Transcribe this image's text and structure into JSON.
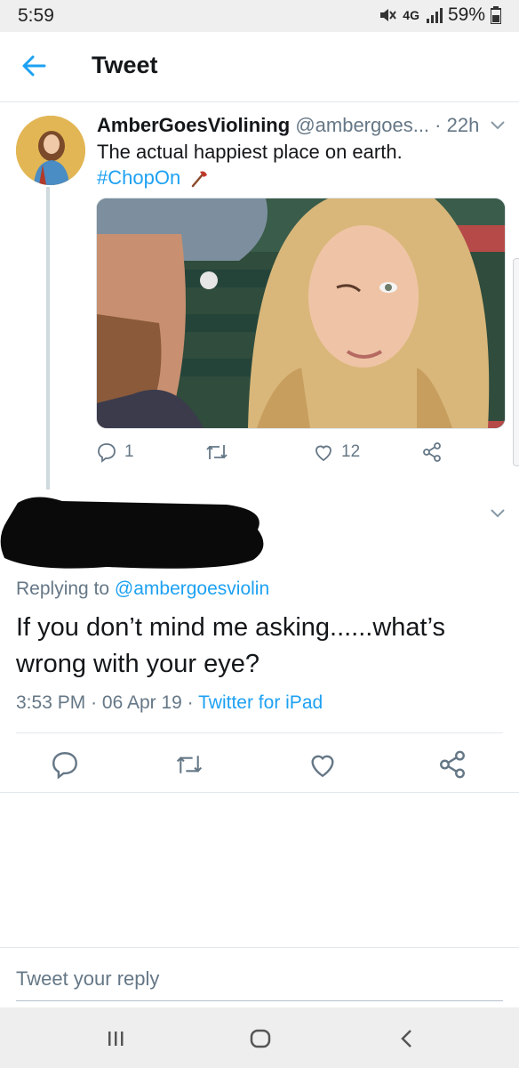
{
  "status_bar": {
    "time": "5:59",
    "network": "4G",
    "battery": "59%",
    "icons": [
      "mute-icon",
      "network-4g-icon",
      "signal-icon",
      "battery-icon"
    ]
  },
  "app_bar": {
    "title": "Tweet",
    "back_icon": "arrow-left-icon"
  },
  "original_tweet": {
    "display_name": "AmberGoesViolining",
    "handle": "@ambergoes...",
    "time": "· 22h",
    "text": "The actual happiest place on earth.",
    "hashtag": "#ChopOn",
    "hashtag_emoji": "axe-emoji",
    "reply_count": "1",
    "retweet_count": "",
    "like_count": "12"
  },
  "reply_tweet": {
    "replying_prefix": "Replying to",
    "replying_to": "@ambergoesviolin",
    "text": "If you don’t mind me asking......what’s wrong with your eye?",
    "time": "3:53 PM",
    "date": "06 Apr 19",
    "source": "Twitter for iPad"
  },
  "composer": {
    "placeholder": "Tweet your reply"
  },
  "colors": {
    "accent": "#1da1f2",
    "secondary_text": "#657786",
    "primary_text": "#14171a",
    "divider": "#e1e8ed"
  }
}
